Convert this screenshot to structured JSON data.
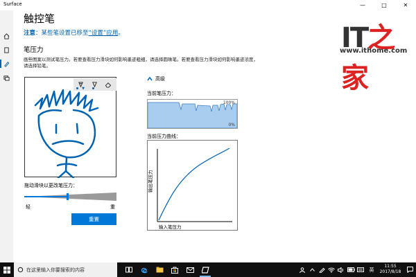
{
  "window": {
    "title": "Surface",
    "controls": {
      "minimize": "—",
      "maximize": "□",
      "close": "✕"
    }
  },
  "rail": {
    "items": [
      "home-icon",
      "laptop-icon",
      "pen-icon",
      "display-icon"
    ],
    "active_index": 2
  },
  "page": {
    "title": "触控笔",
    "notice_label": "注意",
    "notice_text": "：某些笔设置已移至",
    "notice_link": "“设置”应用",
    "notice_end": "。"
  },
  "pressure_section": {
    "title": "笔压力",
    "description": "画些图案以测试笔压力。若要查看压力滑块如何影响墨迹粗细，请选择圆珠笔。若要查看压力滑块如何影响墨迹浓度，请选择铅笔。",
    "tools": [
      "ballpoint-pen-icon",
      "pencil-icon",
      "eraser-icon"
    ],
    "slider_label": "拖动滑块以更改笔压力：",
    "slider_value": 0.47,
    "slider_min_label": "轻",
    "slider_max_label": "重",
    "reset_button": "重置"
  },
  "advanced": {
    "label": "高级",
    "current_pressure_label": "当前笔压力：",
    "pressure_max": "100%",
    "pressure_min": "0%",
    "curve_label": "当前压力曲线：",
    "curve_xlabel": "输入笔压力",
    "curve_ylabel": "输出笔压力"
  },
  "watermark": {
    "logo_it": "IT",
    "logo_char": "之家",
    "url": "www.ithome.com"
  },
  "taskbar": {
    "search_placeholder": "在这里输入你要搜索的内容",
    "apps": [
      "cortana-icon",
      "task-view-icon",
      "edge-icon",
      "file-explorer-icon",
      "store-icon",
      "surface-app-icon"
    ],
    "active_app": "surface-app-icon",
    "tray_lang": "英",
    "time": "11:55",
    "date": "2017/8/18"
  },
  "colors": {
    "accent": "#0078d7",
    "link": "#0063b1",
    "pressure_fill": "#a9cdef",
    "ink": "#0063b1"
  }
}
